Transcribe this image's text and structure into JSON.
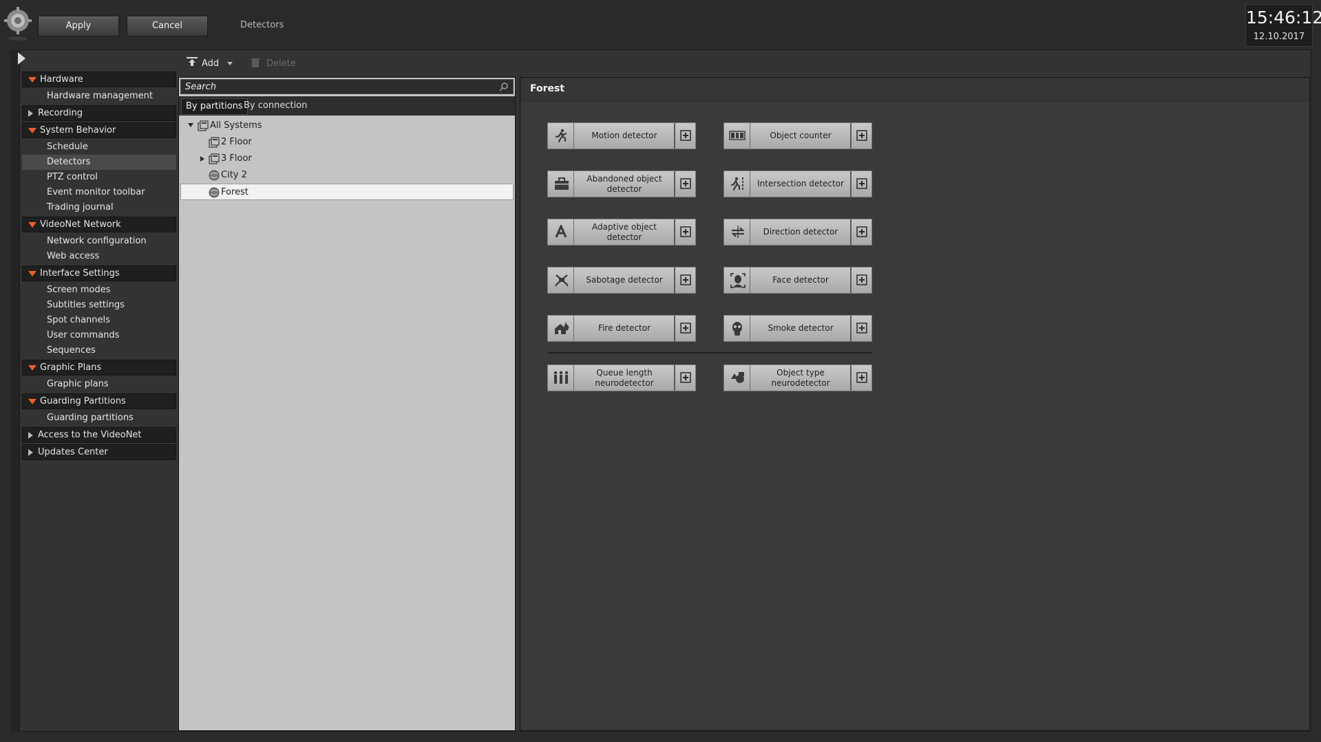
{
  "topbar": {
    "apply_label": "Apply",
    "cancel_label": "Cancel",
    "page_title": "Detectors",
    "clock_time": "15:46:12",
    "clock_date": "12.10.2017"
  },
  "sidebar": {
    "sections": [
      {
        "label": "Hardware",
        "expanded": true,
        "items": [
          "Hardware management"
        ]
      },
      {
        "label": "Recording",
        "expanded": false,
        "items": []
      },
      {
        "label": "System Behavior",
        "expanded": true,
        "items": [
          "Schedule",
          "Detectors",
          "PTZ control",
          "Event monitor toolbar",
          "Trading journal"
        ]
      },
      {
        "label": "VideoNet Network",
        "expanded": true,
        "items": [
          "Network configuration",
          "Web access"
        ]
      },
      {
        "label": "Interface Settings",
        "expanded": true,
        "items": [
          "Screen modes",
          "Subtitles settings",
          "Spot channels",
          "User commands",
          "Sequences"
        ]
      },
      {
        "label": "Graphic Plans",
        "expanded": true,
        "items": [
          "Graphic plans"
        ]
      },
      {
        "label": "Guarding Partitions",
        "expanded": true,
        "items": [
          "Guarding partitions"
        ]
      },
      {
        "label": "Access to the VideoNet",
        "expanded": false,
        "items": []
      },
      {
        "label": "Updates Center",
        "expanded": false,
        "items": []
      }
    ],
    "selected_item": "Detectors"
  },
  "toolbar": {
    "add_label": "Add",
    "delete_label": "Delete"
  },
  "tree_panel": {
    "search_placeholder": "Search",
    "tabs": [
      "By partitions",
      "By connection"
    ],
    "nodes": [
      {
        "label": "All Systems",
        "level": 0,
        "icon": "partition-icon",
        "expander": "down"
      },
      {
        "label": "2 Floor",
        "level": 1,
        "icon": "partition-icon",
        "expander": ""
      },
      {
        "label": "3 Floor",
        "level": 1,
        "icon": "partition-icon",
        "expander": "right"
      },
      {
        "label": "City 2",
        "level": 1,
        "icon": "globe-icon",
        "expander": ""
      },
      {
        "label": "Forest",
        "level": 1,
        "icon": "globe-icon",
        "expander": "",
        "selected": true
      }
    ]
  },
  "content": {
    "title": "Forest",
    "detectors": [
      {
        "label": "Motion detector",
        "icon": "running-man-icon"
      },
      {
        "label": "Object counter",
        "icon": "counter-icon"
      },
      {
        "label": "Abandoned object detector",
        "icon": "suitcase-icon"
      },
      {
        "label": "Intersection detector",
        "icon": "man-crossing-line-icon"
      },
      {
        "label": "Adaptive object detector",
        "icon": "letter-a-icon"
      },
      {
        "label": "Direction detector",
        "icon": "direction-arrows-icon"
      },
      {
        "label": "Sabotage detector",
        "icon": "broken-camera-icon"
      },
      {
        "label": "Face detector",
        "icon": "face-icon"
      },
      {
        "label": "Fire detector",
        "icon": "fire-house-icon"
      },
      {
        "label": "Smoke detector",
        "icon": "gas-mask-icon"
      }
    ],
    "neurodetectors": [
      {
        "label": "Queue length neurodetector",
        "icon": "queue-people-icon"
      },
      {
        "label": "Object type neurodetector",
        "icon": "object-types-icon"
      }
    ]
  }
}
